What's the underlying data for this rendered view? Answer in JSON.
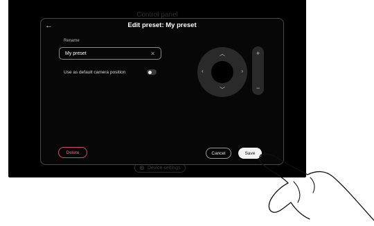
{
  "panel": {
    "title": "Control panel",
    "device_settings_label": "Device settings"
  },
  "dialog": {
    "title": "Edit preset: My preset",
    "back_icon": "arrow-left-icon",
    "rename_label": "Rename",
    "rename_value": "My preset",
    "clear_icon": "close-icon",
    "default_camera_label": "Use as default camera position",
    "default_camera_toggle_on": false
  },
  "camera_controls": {
    "pan_up_icon": "chevron-up-icon",
    "pan_down_icon": "chevron-down-icon",
    "pan_left_icon": "chevron-left-icon",
    "pan_right_icon": "chevron-right-icon",
    "zoom_in_glyph": "+",
    "zoom_out_glyph": "−"
  },
  "actions": {
    "delete_label": "Delete",
    "cancel_label": "Cancel",
    "save_label": "Save"
  },
  "colors": {
    "delete_accent": "#d2506f",
    "background": "#000000"
  }
}
